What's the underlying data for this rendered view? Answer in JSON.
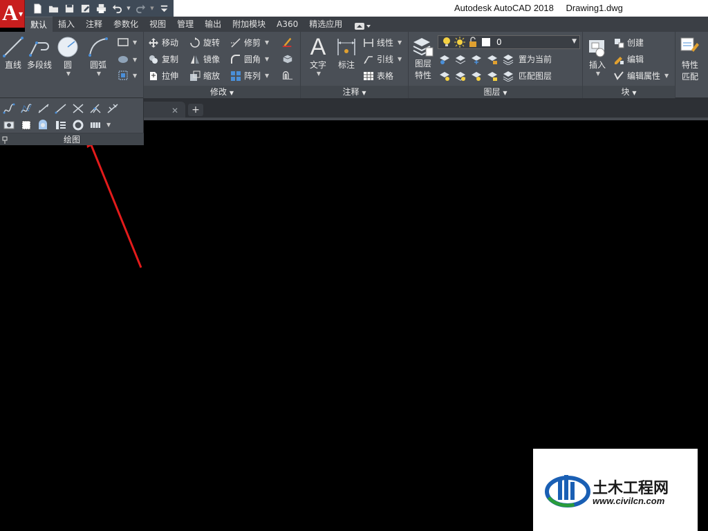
{
  "app": {
    "title": "Autodesk AutoCAD 2018",
    "document": "Drawing1.dwg",
    "menu_letter": "A"
  },
  "quick_access": [
    "new-icon",
    "open-icon",
    "save-icon",
    "saveas-icon",
    "print-icon",
    "undo-icon",
    "redo-icon",
    "customize-icon"
  ],
  "tabs": [
    {
      "label": "默认",
      "active": true
    },
    {
      "label": "插入"
    },
    {
      "label": "注释"
    },
    {
      "label": "参数化"
    },
    {
      "label": "视图"
    },
    {
      "label": "管理"
    },
    {
      "label": "输出"
    },
    {
      "label": "附加模块"
    },
    {
      "label": "A360"
    },
    {
      "label": "精选应用"
    }
  ],
  "ribbon": {
    "draw": {
      "line": "直线",
      "polyline": "多段线",
      "circle": "圆",
      "arc": "圆弧",
      "label": "绘图"
    },
    "modify": {
      "move": "移动",
      "rotate": "旋转",
      "trim": "修剪",
      "copy": "复制",
      "mirror": "镜像",
      "fillet": "圆角",
      "stretch": "拉伸",
      "scale": "缩放",
      "array": "阵列",
      "label": "修改"
    },
    "annotation": {
      "text": "文字",
      "dimension": "标注",
      "linear": "线性",
      "leader": "引线",
      "table": "表格",
      "label": "注释"
    },
    "layers": {
      "properties_line1": "图层",
      "properties_line2": "特性",
      "current_layer": "0",
      "make_current": "置为当前",
      "match_layer": "匹配图层",
      "label": "图层"
    },
    "block": {
      "insert": "插入",
      "create": "创建",
      "edit": "编辑",
      "edit_attributes": "编辑属性",
      "label": "块"
    },
    "properties": {
      "match_line1": "特性",
      "match_line2": "匹配"
    }
  },
  "colors": {
    "ribbon_bg": "#4a4f56",
    "tab_bg": "#3b3f45",
    "app_red": "#c81e1e",
    "arrow_red": "#e31b1b",
    "canvas": "#000000"
  },
  "watermark": {
    "name": "土木工程网",
    "url": "www.civilcn.com"
  }
}
